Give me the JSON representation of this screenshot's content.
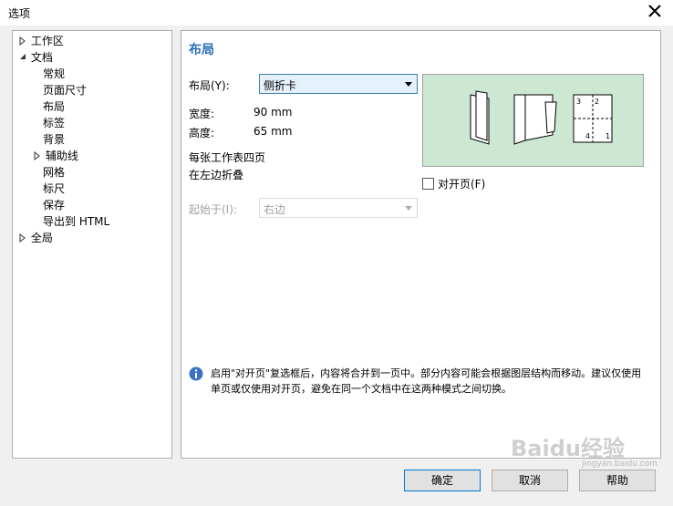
{
  "window": {
    "title": "选项"
  },
  "tree": {
    "items": [
      {
        "label": "工作区",
        "toggle": "collapsed"
      },
      {
        "label": "文档",
        "toggle": "expanded"
      },
      {
        "label": "常规"
      },
      {
        "label": "页面尺寸"
      },
      {
        "label": "布局",
        "selected": true
      },
      {
        "label": "标签"
      },
      {
        "label": "背景"
      },
      {
        "label": "辅助线",
        "toggle": "collapsed"
      },
      {
        "label": "网格"
      },
      {
        "label": "标尺"
      },
      {
        "label": "保存"
      },
      {
        "label": "导出到 HTML"
      },
      {
        "label": "全局",
        "toggle": "collapsed"
      }
    ]
  },
  "panel": {
    "heading": "布局",
    "layout_label": "布局(Y):",
    "layout_value": "侧折卡",
    "width_label": "宽度:",
    "width_value": "90 mm",
    "height_label": "高度:",
    "height_value": "65 mm",
    "desc1": "每张工作表四页",
    "desc2": "在左边折叠",
    "start_label": "起始于(I):",
    "start_value": "右边",
    "facing_label": "对开页(F)",
    "info": "启用\"对开页\"复选框后，内容将合并到一页中。部分内容可能会根据图层结构而移动。建议仅使用单页或仅使用对开页，避免在同一个文档中在这两种模式之间切换。",
    "preview_numbers": [
      "3",
      "2",
      "4",
      "1"
    ]
  },
  "buttons": {
    "ok": "确定",
    "cancel": "取消",
    "help": "帮助"
  },
  "watermark": {
    "text": "Baidu经验",
    "sub": "jingyan.baidu.com"
  },
  "colors": {
    "accent": "#2a6fb5",
    "preview_bg": "#cde8d2"
  }
}
